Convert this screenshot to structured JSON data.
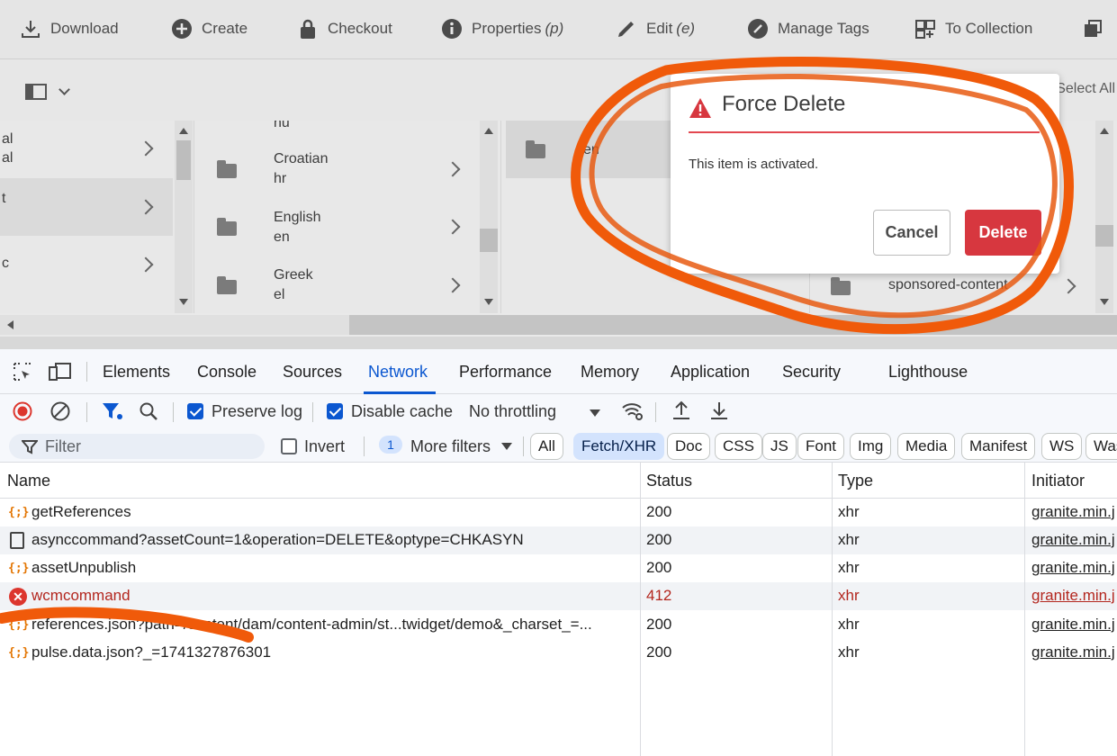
{
  "aem": {
    "toolbar": {
      "download": "Download",
      "create": "Create",
      "checkout": "Checkout",
      "properties": "Properties",
      "properties_key": "(p)",
      "edit": "Edit",
      "edit_key": "(e)",
      "manage_tags": "Manage Tags",
      "to_collection": "To Collection"
    },
    "select_all": "Select All",
    "col1": {
      "items": [
        {
          "l1": "al",
          "l2": "al"
        },
        {
          "l1": "t",
          "l2": ""
        },
        {
          "l1": "c",
          "l2": ""
        }
      ]
    },
    "col2": {
      "items": [
        {
          "name": "hu",
          "code": ""
        },
        {
          "name": "Croatian",
          "code": "hr"
        },
        {
          "name": "English",
          "code": "en"
        },
        {
          "name": "Greek",
          "code": "el"
        }
      ]
    },
    "col3": {
      "items": [
        {
          "name": "en"
        }
      ]
    },
    "col4": {
      "items": [
        {
          "name": "sponsored-content"
        }
      ]
    }
  },
  "dialog": {
    "title": "Force Delete",
    "message": "This item is activated.",
    "cancel": "Cancel",
    "delete": "Delete"
  },
  "devtools": {
    "tabs": [
      "Elements",
      "Console",
      "Sources",
      "Network",
      "Performance",
      "Memory",
      "Application",
      "Security",
      "Lighthouse"
    ],
    "active_tab": "Network",
    "toolbar": {
      "preserve_log": "Preserve log",
      "disable_cache": "Disable cache",
      "throttling": "No throttling"
    },
    "filterbar": {
      "filter_placeholder": "Filter",
      "invert": "Invert",
      "more_filters_count": "1",
      "more_filters": "More filters",
      "chips": [
        "All",
        "Fetch/XHR",
        "Doc",
        "CSS",
        "JS",
        "Font",
        "Img",
        "Media",
        "Manifest",
        "WS",
        "Was"
      ],
      "selected_chip": "Fetch/XHR"
    },
    "table": {
      "headers": {
        "name": "Name",
        "status": "Status",
        "type": "Type",
        "initiator": "Initiator"
      },
      "rows": [
        {
          "name": "getReferences",
          "status": "200",
          "type": "xhr",
          "initiator": "granite.min.j",
          "icon": "json-icon"
        },
        {
          "name": "asynccommand?assetCount=1&operation=DELETE&optype=CHKASYN",
          "status": "200",
          "type": "xhr",
          "initiator": "granite.min.j",
          "icon": "document-icon"
        },
        {
          "name": "assetUnpublish",
          "status": "200",
          "type": "xhr",
          "initiator": "granite.min.j",
          "icon": "json-icon"
        },
        {
          "name": "wcmcommand",
          "status": "412",
          "type": "xhr",
          "initiator": "granite.min.j",
          "icon": "error-icon"
        },
        {
          "name": "references.json?path=/content/dam/content-admin/st...twidget/demo&_charset_=...",
          "status": "200",
          "type": "xhr",
          "initiator": "granite.min.j",
          "icon": "json-icon"
        },
        {
          "name": "pulse.data.json?_=1741327876301",
          "status": "200",
          "type": "xhr",
          "initiator": "granite.min.j",
          "icon": "json-icon"
        }
      ]
    }
  },
  "colors": {
    "accent": "#0b57d0",
    "error": "#b3261e",
    "danger_button": "#d7373f",
    "annotation": "#f05a0a"
  }
}
